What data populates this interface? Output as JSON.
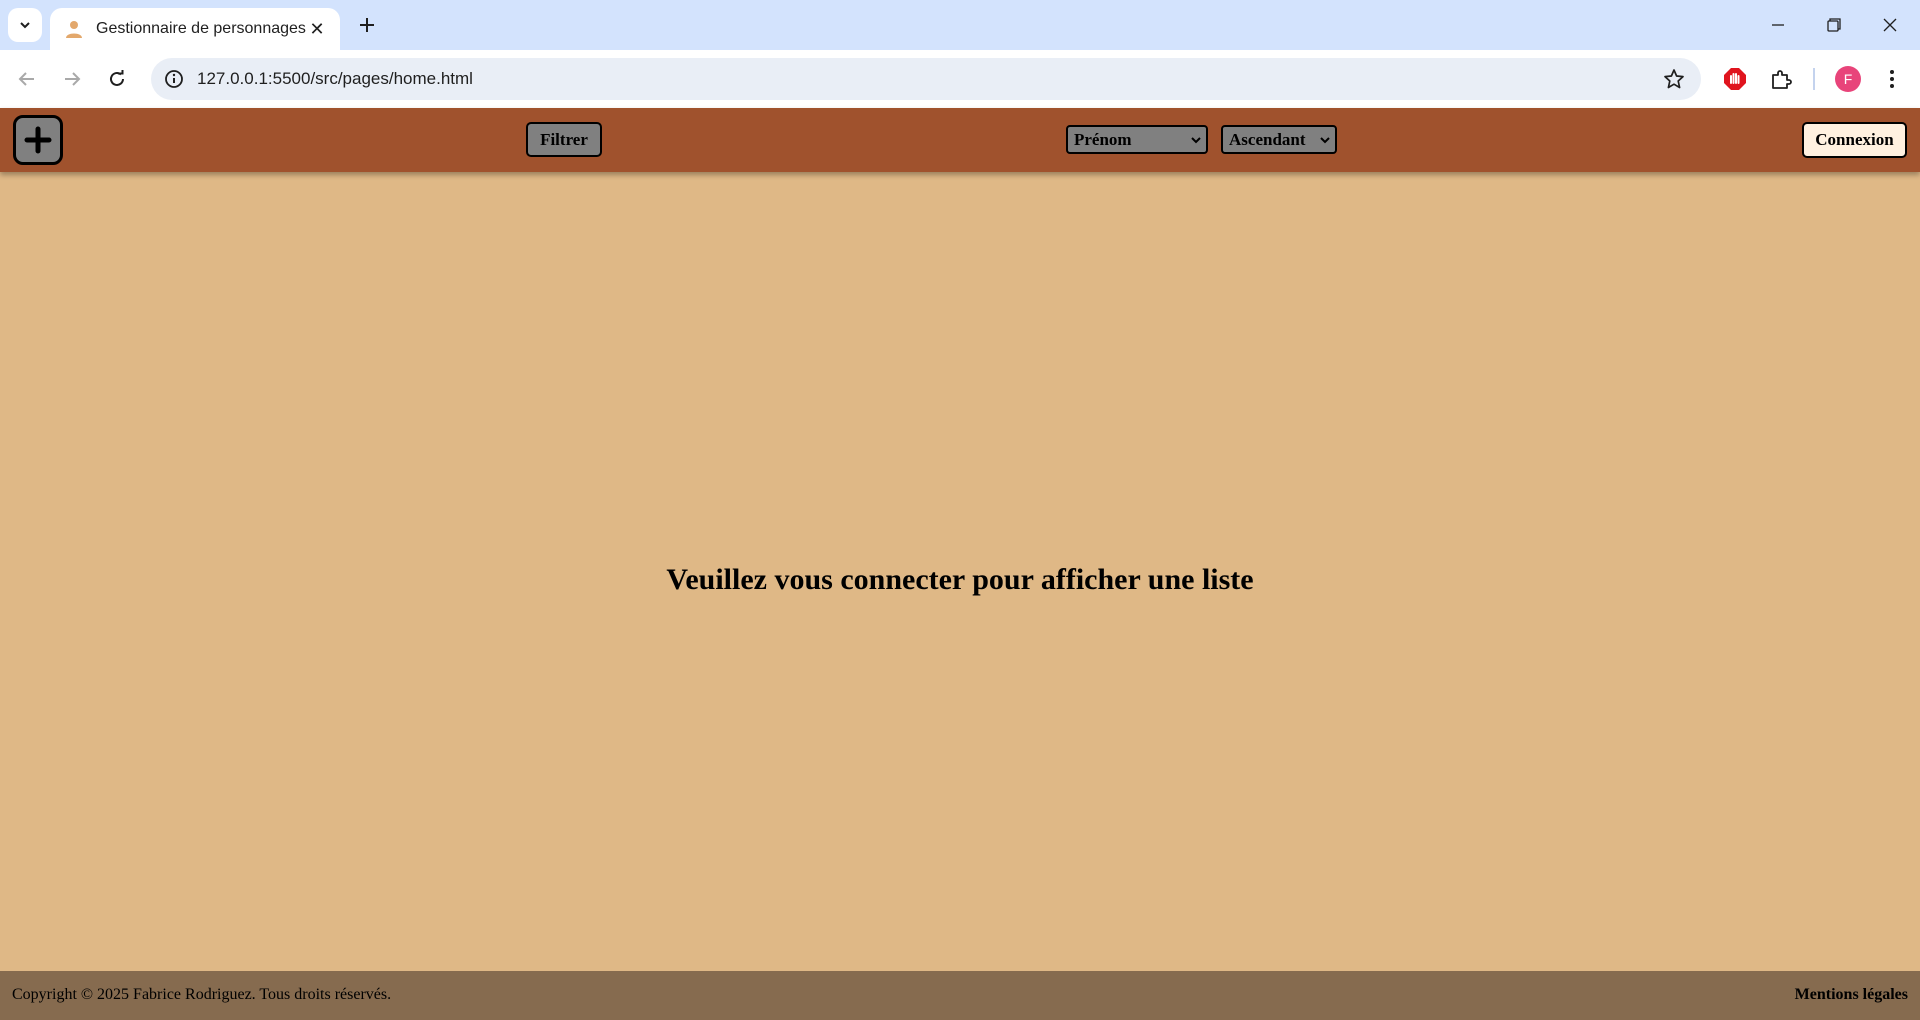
{
  "browser": {
    "tab_title": "Gestionnaire de personnages",
    "url": "127.0.0.1:5500/src/pages/home.html",
    "profile_initial": "F",
    "icons": [
      "tab-list-icon",
      "person-icon",
      "close-icon",
      "plus-icon",
      "minimize-icon",
      "restore-icon",
      "window-close-icon",
      "back-icon",
      "forward-icon",
      "reload-icon",
      "info-icon",
      "star-icon",
      "adblock-icon",
      "extensions-icon",
      "menu-icon"
    ]
  },
  "header": {
    "add_icon": "plus-icon",
    "filter_label": "Filtrer",
    "sort_field_selected": "Prénom",
    "sort_order_selected": "Ascendant",
    "login_label": "Connexion"
  },
  "main": {
    "message": "Veuillez vous connecter pour afficher une liste"
  },
  "footer": {
    "copyright": "Copyright © 2025 Fabrice Rodriguez. Tous droits réservés.",
    "legal_link": "Mentions légales"
  },
  "colors": {
    "header_bg": "#a0522d",
    "page_bg": "#dfb886",
    "footer_bg": "#866b4f",
    "button_bg": "#808080",
    "login_bg": "#fff1e0"
  }
}
